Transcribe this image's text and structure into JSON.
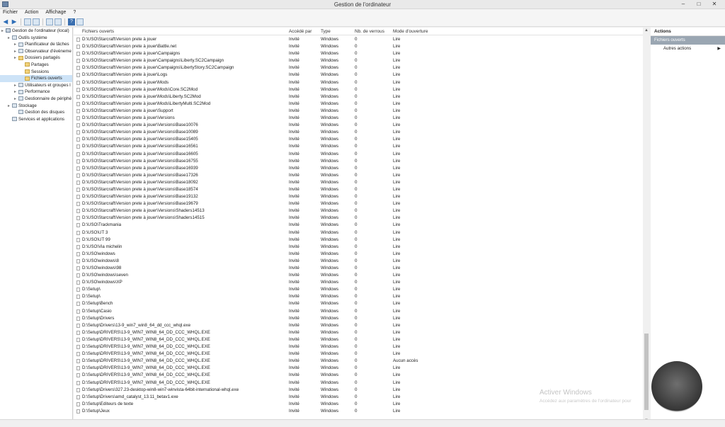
{
  "window": {
    "title": "Gestion de l'ordinateur",
    "controls": [
      "–",
      "□",
      "✕"
    ]
  },
  "menu": [
    "Fichier",
    "Action",
    "Affichage",
    "?"
  ],
  "tree": [
    {
      "label": "Gestion de l'ordinateur (local)",
      "level": 0,
      "icon": "computer-icon"
    },
    {
      "label": "Outils système",
      "level": 1,
      "icon": "tools-icon"
    },
    {
      "label": "Planificateur de tâches",
      "level": 2,
      "icon": "clock-icon"
    },
    {
      "label": "Observateur d'événeme",
      "level": 2,
      "icon": "event-icon"
    },
    {
      "label": "Dossiers partagés",
      "level": 2,
      "icon": "folder-icon"
    },
    {
      "label": "Partages",
      "level": 3,
      "icon": "folder-icon"
    },
    {
      "label": "Sessions",
      "level": 3,
      "icon": "folder-icon"
    },
    {
      "label": "Fichiers ouverts",
      "level": 3,
      "icon": "folder-icon",
      "selected": true
    },
    {
      "label": "Utilisateurs et groupes l",
      "level": 2,
      "icon": "users-icon"
    },
    {
      "label": "Performance",
      "level": 2,
      "icon": "performance-icon"
    },
    {
      "label": "Gestionnaire de périphé",
      "level": 2,
      "icon": "device-icon"
    },
    {
      "label": "Stockage",
      "level": 1,
      "icon": "storage-icon"
    },
    {
      "label": "Gestion des disques",
      "level": 2,
      "icon": "disk-icon"
    },
    {
      "label": "Services et applications",
      "level": 1,
      "icon": "services-icon"
    }
  ],
  "columns": [
    "Fichiers ouverts",
    "Accédé par",
    "Type",
    "Nb. de verrous",
    "Mode d'ouverture"
  ],
  "rows": [
    [
      "D:\\USO\\Starcraft\\Version prete à jouer",
      "Invité",
      "Windows",
      "0",
      "Lire"
    ],
    [
      "D:\\USO\\Starcraft\\Version prete à jouer\\Battle.net",
      "Invité",
      "Windows",
      "0",
      "Lire"
    ],
    [
      "D:\\USO\\Starcraft\\Version prete à jouer\\Campaigns",
      "Invité",
      "Windows",
      "0",
      "Lire"
    ],
    [
      "D:\\USO\\Starcraft\\Version prete à jouer\\Campaigns\\Liberty.SC2Campaign",
      "Invité",
      "Windows",
      "0",
      "Lire"
    ],
    [
      "D:\\USO\\Starcraft\\Version prete à jouer\\Campaigns\\LibertyStory.SC2Campaign",
      "Invité",
      "Windows",
      "0",
      "Lire"
    ],
    [
      "D:\\USO\\Starcraft\\Version prete à jouer\\Logs",
      "Invité",
      "Windows",
      "0",
      "Lire"
    ],
    [
      "D:\\USO\\Starcraft\\Version prete à jouer\\Mods",
      "Invité",
      "Windows",
      "0",
      "Lire"
    ],
    [
      "D:\\USO\\Starcraft\\Version prete à jouer\\Mods\\Core.SC2Mod",
      "Invité",
      "Windows",
      "0",
      "Lire"
    ],
    [
      "D:\\USO\\Starcraft\\Version prete à jouer\\Mods\\Liberty.SC2Mod",
      "Invité",
      "Windows",
      "0",
      "Lire"
    ],
    [
      "D:\\USO\\Starcraft\\Version prete à jouer\\Mods\\LibertyMulti.SC2Mod",
      "Invité",
      "Windows",
      "0",
      "Lire"
    ],
    [
      "D:\\USO\\Starcraft\\Version prete à jouer\\Support",
      "Invité",
      "Windows",
      "0",
      "Lire"
    ],
    [
      "D:\\USO\\Starcraft\\Version prete à jouer\\Versions",
      "Invité",
      "Windows",
      "0",
      "Lire"
    ],
    [
      "D:\\USO\\Starcraft\\Version prete à jouer\\Versions\\Base10076",
      "Invité",
      "Windows",
      "0",
      "Lire"
    ],
    [
      "D:\\USO\\Starcraft\\Version prete à jouer\\Versions\\Base10089",
      "Invité",
      "Windows",
      "0",
      "Lire"
    ],
    [
      "D:\\USO\\Starcraft\\Version prete à jouer\\Versions\\Base15405",
      "Invité",
      "Windows",
      "0",
      "Lire"
    ],
    [
      "D:\\USO\\Starcraft\\Version prete à jouer\\Versions\\Base16561",
      "Invité",
      "Windows",
      "0",
      "Lire"
    ],
    [
      "D:\\USO\\Starcraft\\Version prete à jouer\\Versions\\Base16605",
      "Invité",
      "Windows",
      "0",
      "Lire"
    ],
    [
      "D:\\USO\\Starcraft\\Version prete à jouer\\Versions\\Base16755",
      "Invité",
      "Windows",
      "0",
      "Lire"
    ],
    [
      "D:\\USO\\Starcraft\\Version prete à jouer\\Versions\\Base16939",
      "Invité",
      "Windows",
      "0",
      "Lire"
    ],
    [
      "D:\\USO\\Starcraft\\Version prete à jouer\\Versions\\Base17326",
      "Invité",
      "Windows",
      "0",
      "Lire"
    ],
    [
      "D:\\USO\\Starcraft\\Version prete à jouer\\Versions\\Base18092",
      "Invité",
      "Windows",
      "0",
      "Lire"
    ],
    [
      "D:\\USO\\Starcraft\\Version prete à jouer\\Versions\\Base18574",
      "Invité",
      "Windows",
      "0",
      "Lire"
    ],
    [
      "D:\\USO\\Starcraft\\Version prete à jouer\\Versions\\Base19132",
      "Invité",
      "Windows",
      "0",
      "Lire"
    ],
    [
      "D:\\USO\\Starcraft\\Version prete à jouer\\Versions\\Base19679",
      "Invité",
      "Windows",
      "0",
      "Lire"
    ],
    [
      "D:\\USO\\Starcraft\\Version prete à jouer\\Versions\\Shaders14513",
      "Invité",
      "Windows",
      "0",
      "Lire"
    ],
    [
      "D:\\USO\\Starcraft\\Version prete à jouer\\Versions\\Shaders14515",
      "Invité",
      "Windows",
      "0",
      "Lire"
    ],
    [
      "D:\\USO\\Trackmania",
      "Invité",
      "Windows",
      "0",
      "Lire"
    ],
    [
      "D:\\USO\\UT 3",
      "Invité",
      "Windows",
      "0",
      "Lire"
    ],
    [
      "D:\\USO\\UT 99",
      "Invité",
      "Windows",
      "0",
      "Lire"
    ],
    [
      "D:\\USO\\Via michelin",
      "Invité",
      "Windows",
      "0",
      "Lire"
    ],
    [
      "D:\\USO\\windows",
      "Invité",
      "Windows",
      "0",
      "Lire"
    ],
    [
      "D:\\USO\\windows\\8",
      "Invité",
      "Windows",
      "0",
      "Lire"
    ],
    [
      "D:\\USO\\windows\\98",
      "Invité",
      "Windows",
      "0",
      "Lire"
    ],
    [
      "D:\\USO\\windows\\seven",
      "Invité",
      "Windows",
      "0",
      "Lire"
    ],
    [
      "D:\\USO\\windows\\XP",
      "Invité",
      "Windows",
      "0",
      "Lire"
    ],
    [
      "D:\\Setup\\",
      "Invité",
      "Windows",
      "0",
      "Lire"
    ],
    [
      "D:\\Setup\\",
      "Invité",
      "Windows",
      "0",
      "Lire"
    ],
    [
      "D:\\Setup\\Bench",
      "Invité",
      "Windows",
      "0",
      "Lire"
    ],
    [
      "D:\\Setup\\Casio",
      "Invité",
      "Windows",
      "0",
      "Lire"
    ],
    [
      "D:\\Setup\\Drivers",
      "Invité",
      "Windows",
      "0",
      "Lire"
    ],
    [
      "D:\\Setup\\Drivers\\13-9_win7_win8_64_dd_ccc_whql.exe",
      "Invité",
      "Windows",
      "0",
      "Lire"
    ],
    [
      "D:\\Setup\\DRIVERS\\13-9_WIN7_WIN8_64_DD_CCC_WHQL.EXE",
      "Invité",
      "Windows",
      "0",
      "Lire"
    ],
    [
      "D:\\Setup\\DRIVERS\\13-9_WIN7_WIN8_64_DD_CCC_WHQL.EXE",
      "Invité",
      "Windows",
      "0",
      "Lire"
    ],
    [
      "D:\\Setup\\DRIVERS\\13-9_WIN7_WIN8_64_DD_CCC_WHQL.EXE",
      "Invité",
      "Windows",
      "0",
      "Lire"
    ],
    [
      "D:\\Setup\\DRIVERS\\13-9_WIN7_WIN8_64_DD_CCC_WHQL.EXE",
      "Invité",
      "Windows",
      "0",
      "Lire"
    ],
    [
      "D:\\Setup\\DRIVERS\\13-9_WIN7_WIN8_64_DD_CCC_WHQL.EXE",
      "Invité",
      "Windows",
      "0",
      "Aucun accès"
    ],
    [
      "D:\\Setup\\DRIVERS\\13-9_WIN7_WIN8_64_DD_CCC_WHQL.EXE",
      "Invité",
      "Windows",
      "0",
      "Lire"
    ],
    [
      "D:\\Setup\\DRIVERS\\13-9_WIN7_WIN8_64_DD_CCC_WHQL.EXE",
      "Invité",
      "Windows",
      "0",
      "Lire"
    ],
    [
      "D:\\Setup\\DRIVERS\\13-9_WIN7_WIN8_64_DD_CCC_WHQL.EXE",
      "Invité",
      "Windows",
      "0",
      "Lire"
    ],
    [
      "D:\\Setup\\Drivers\\327.23-desktop-win8-win7-winvista-64bit-international-whql.exe",
      "Invité",
      "Windows",
      "0",
      "Lire"
    ],
    [
      "D:\\Setup\\Drivers\\amd_catalyst_13.11_betav1.exe",
      "Invité",
      "Windows",
      "0",
      "Lire"
    ],
    [
      "D:\\Setup\\Editeurs de texte",
      "Invité",
      "Windows",
      "0",
      "Lire"
    ],
    [
      "D:\\Setup\\Jeux",
      "Invité",
      "Windows",
      "0",
      "Lire"
    ]
  ],
  "actions": {
    "header": "Actions",
    "selected": "Fichiers ouverts",
    "more": "Autres actions"
  },
  "watermark": {
    "title": "Activer Windows",
    "subtitle": "Accédez aux paramètres de l'ordinateur pour"
  }
}
